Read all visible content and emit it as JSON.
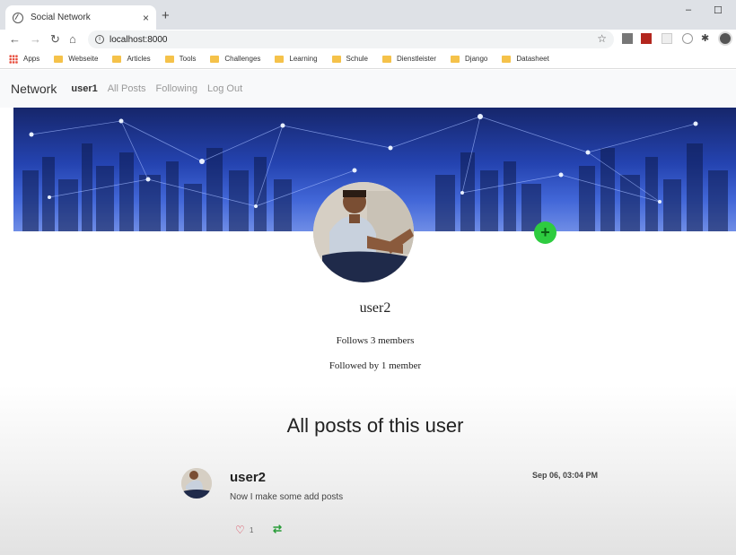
{
  "browser": {
    "tab_title": "Social Network",
    "tab_close": "×",
    "new_tab": "+",
    "url": "localhost:8000",
    "minimize": "‒",
    "maximize": "☐",
    "bookmarks": [
      "Apps",
      "Webseite",
      "Articles",
      "Tools",
      "Challenges",
      "Learning",
      "Schule",
      "Dienstleister",
      "Django",
      "Datasheet"
    ]
  },
  "navbar": {
    "brand": "Network",
    "current_user": "user1",
    "all_posts": "All Posts",
    "following": "Following",
    "logout": "Log Out"
  },
  "profile": {
    "username": "user2",
    "follows": "Follows 3 members",
    "followed_by": "Followed by 1 member",
    "follow_button": "+"
  },
  "posts_section": {
    "title": "All posts of this user"
  },
  "posts": [
    {
      "user": "user2",
      "date": "Sep 06, 03:04 PM",
      "text": "Now I make some add posts",
      "likes": "1"
    }
  ],
  "colors": {
    "accent_green": "#2ecc40",
    "like_red": "#d9334a",
    "retweet_green": "#2a9d3a"
  }
}
